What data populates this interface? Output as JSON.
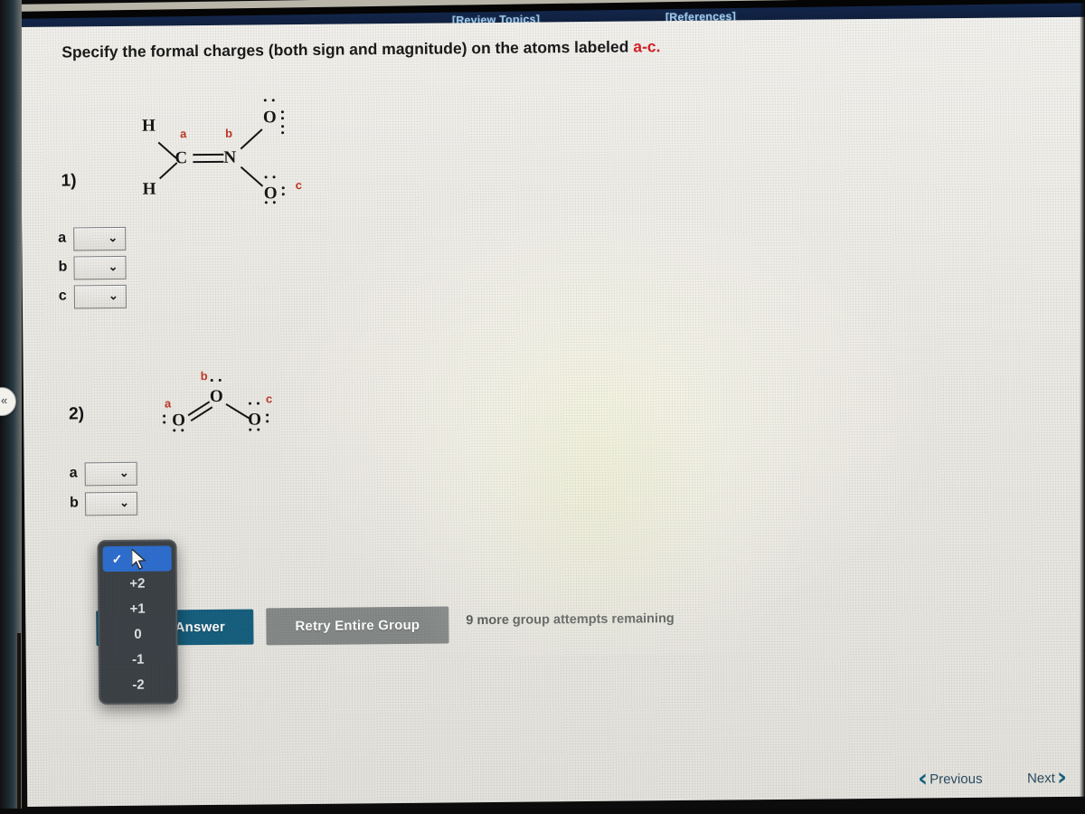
{
  "app_bar": {
    "review_topics_label": "[Review Topics]",
    "references_label": "[References]"
  },
  "prompt": {
    "text_before": "Specify the formal charges (both sign and magnitude) on the atoms labeled ",
    "accent_text": "a-c.",
    "accent_color": "#d81f26"
  },
  "questions": [
    {
      "number": "1)",
      "molecule": {
        "name": "nitromethane-like",
        "atoms": [
          "H",
          "H",
          "C",
          "N",
          "O",
          "O"
        ],
        "labels": [
          "a",
          "b",
          "c"
        ]
      },
      "answer_rows": [
        {
          "label": "a",
          "value": "",
          "placeholder": ""
        },
        {
          "label": "b",
          "value": "",
          "placeholder": ""
        },
        {
          "label": "c",
          "value": "",
          "placeholder": ""
        }
      ]
    },
    {
      "number": "2)",
      "molecule": {
        "name": "ozone",
        "atoms": [
          "O",
          "O",
          "O"
        ],
        "labels": [
          "a",
          "b",
          "c"
        ]
      },
      "answer_rows": [
        {
          "label": "a",
          "value": "",
          "placeholder": ""
        },
        {
          "label": "b",
          "value": "",
          "placeholder": ""
        }
      ]
    }
  ],
  "dropdown": {
    "open": true,
    "selected_index": 0,
    "check_glyph": "✓",
    "options": [
      "",
      "+2",
      "+1",
      "0",
      "-1",
      "-2"
    ]
  },
  "buttons": {
    "submit_label": "Submit Answer",
    "submit_visible_label": "Answer",
    "submit_color": "#17607f",
    "retry_label": "Retry Entire Group",
    "retry_color": "#868a89"
  },
  "status": {
    "attempts_text": "9 more group attempts remaining"
  },
  "navigation": {
    "previous_label": "Previous",
    "next_label": "Next",
    "previous_chevron": "‹",
    "next_chevron": "›",
    "accent_color": "#12627f"
  },
  "left_handle": {
    "glyph": "«"
  },
  "select_chevron": "⌄"
}
